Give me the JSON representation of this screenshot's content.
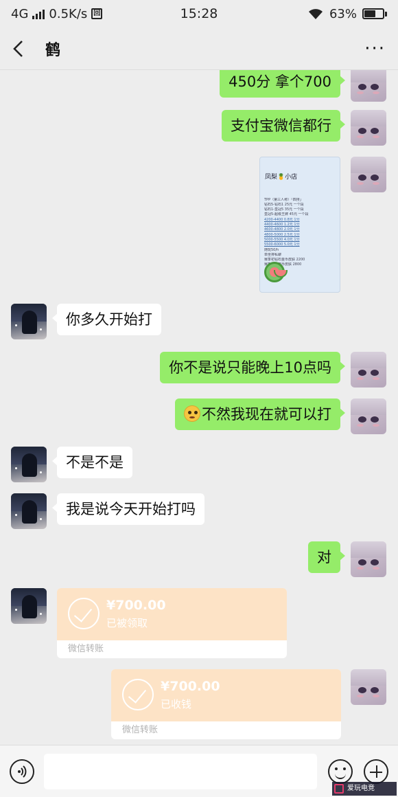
{
  "status_bar": {
    "network": "4G",
    "speed": "0.5K/s",
    "time": "15:28",
    "battery": "63%",
    "battery_level": 0.63
  },
  "header": {
    "title": "鹤"
  },
  "messages": {
    "m1": "450分  拿个700",
    "m2": "支付宝微信都行",
    "m3": "你多久开始打",
    "m4": "你不是说只能晚上10点吗",
    "m5": "不然我现在就可以打",
    "m6": "不是不是",
    "m7": "我是说今天开始打吗",
    "m8": "对"
  },
  "image_message": {
    "title": "凤梨🍍小店",
    "lines": [
      "TPP（第三人称）「四排」",
      "钻石5-钻石1      25元    一个段",
      "钻石1-皇冠5      35元    一个段",
      "皇冠5-超级王牌   45元    一个段",
      "4200-4400   0.8元   1分",
      "4400-4600   1.2元   1分",
      "4600-4800   2.0元   1分",
      "4800-5000   2.5元   1分",
      "5000-5500   4.0元   1分",
      "5500-6000   5.0元   1分",
      "随玩50/h",
      "单坐排私聊",
      "赛季初钻石金币皮肤 2200",
      "赛季初精英币皮肤 2800"
    ]
  },
  "transfers": {
    "received": {
      "amount": "¥700.00",
      "status": "已被领取",
      "label": "微信转账"
    },
    "collected": {
      "amount": "¥700.00",
      "status": "已收钱",
      "label": "微信转账"
    }
  },
  "input": {
    "placeholder": ""
  },
  "watermark": "爱玩电竞",
  "colors": {
    "self_bubble": "#95ec69",
    "other_bubble": "#ffffff",
    "transfer": "#fde3c6",
    "background": "#ededed"
  }
}
